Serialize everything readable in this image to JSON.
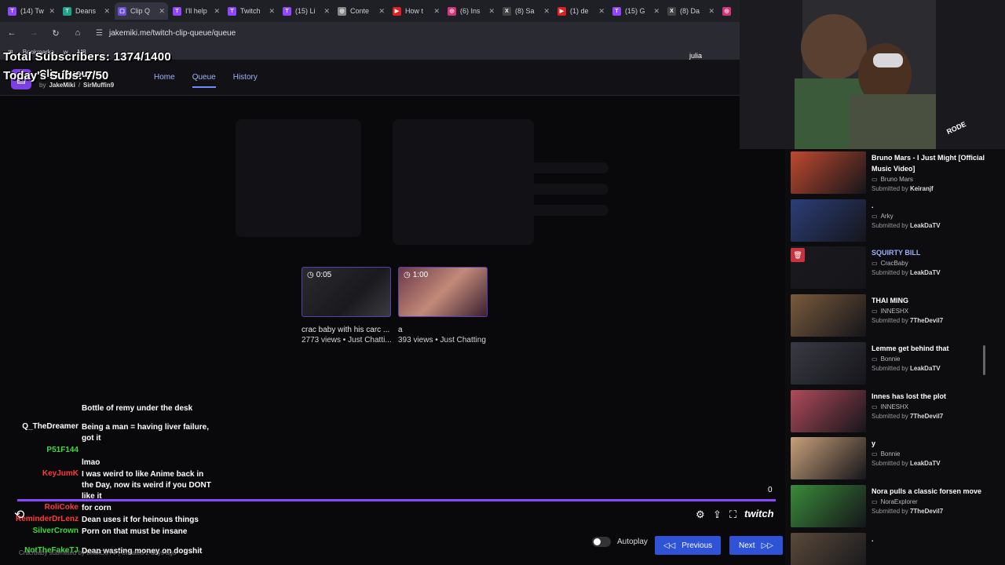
{
  "browser": {
    "tabs": [
      {
        "label": "(14) Tw",
        "color": "#9146ff",
        "glyph": "T"
      },
      {
        "label": "Deans",
        "color": "#1fa58c",
        "glyph": "T"
      },
      {
        "label": "Clip Q",
        "color": "#6f4ce0",
        "glyph": "▢",
        "active": true
      },
      {
        "label": "I'll help",
        "color": "#9146ff",
        "glyph": "T"
      },
      {
        "label": "Twitch",
        "color": "#9146ff",
        "glyph": "T"
      },
      {
        "label": "(15) Li",
        "color": "#9146ff",
        "glyph": "T"
      },
      {
        "label": "Conte",
        "color": "#888888",
        "glyph": "◎"
      },
      {
        "label": "How t",
        "color": "#e02020",
        "glyph": "▶"
      },
      {
        "label": "(6) Ins",
        "color": "#d6337a",
        "glyph": "◎"
      },
      {
        "label": "(8) Sa",
        "color": "#444444",
        "glyph": "X"
      },
      {
        "label": "(1) de",
        "color": "#e02020",
        "glyph": "▶"
      },
      {
        "label": "(15) G",
        "color": "#9146ff",
        "glyph": "T"
      },
      {
        "label": "(8) Da",
        "color": "#444444",
        "glyph": "X"
      },
      {
        "label": "",
        "color": "#d6337a",
        "glyph": "◎"
      }
    ],
    "tab_close": "✕",
    "url": "jakemiki.me/twitch-clip-queue/queue",
    "bookmarks": [
      "Bookmarks",
      "w",
      "M8"
    ]
  },
  "overlay": {
    "total_subs": "Total Subscribers: 1374/1400",
    "today_subs": "Today's Subs: 7/50",
    "name_tag": "julia"
  },
  "site": {
    "brand": "Clip Queue",
    "by_label": "by",
    "author1": "JakeMiki",
    "author2": "SirMuffin9",
    "nav": [
      {
        "label": "Home"
      },
      {
        "label": "Queue",
        "active": true
      },
      {
        "label": "History"
      }
    ]
  },
  "clips": [
    {
      "duration": "0:05",
      "title": "crac baby with his carc ...",
      "meta": "2773 views • Just Chatti..."
    },
    {
      "duration": "1:00",
      "title": "a",
      "meta": "393 views • Just Chatting"
    }
  ],
  "chat": [
    {
      "user": "",
      "msg": "Bottle of remy under the desk",
      "color": "#8a63d2"
    },
    {
      "user": "Q_TheDreamer",
      "msg": "Being a man = having liver failure, got it",
      "color": "#ffffff"
    },
    {
      "user": "P51F144",
      "msg": "",
      "color": "#3bdc3b"
    },
    {
      "user": "",
      "msg": "lmao",
      "color": "#5a5aff"
    },
    {
      "user": "KeyJumK",
      "msg": "I was weird to like Anime back in the Day, now its weird if you DONT like it",
      "color": "#ff3b3b"
    },
    {
      "user": "RoliCoke",
      "msg": "for corn",
      "color": "#ff3b3b"
    },
    {
      "user": "ReminderDrLenz",
      "msg": "Dean uses it for heinous things",
      "color": "#ff3b3b"
    },
    {
      "user": "SilverCrown",
      "msg": "Porn on that must be insane",
      "color": "#3bdc3b"
    },
    {
      "user": "NotTheFakeTJ",
      "msg": "Dean wasting money on dogshit",
      "color": "#3bdc3b"
    }
  ],
  "player": {
    "progress_value": "0",
    "progress_fraction": 1.0,
    "twitch_label": "twitch",
    "autoplay_label": "Autoplay",
    "autoplay_on": false,
    "prev_label": "Previous",
    "next_label": "Next"
  },
  "queue": [
    {
      "title": "Bruno Mars - I Just Might [Official Music Video]",
      "channel": "Bruno Mars",
      "submitted_label": "Submitted by",
      "submitter": "Keiranjf",
      "highlight": false,
      "thumb": "#c0492f"
    },
    {
      "title": ".",
      "channel": "Arky",
      "submitted_label": "Submitted by",
      "submitter": "LeakDaTV",
      "highlight": false,
      "thumb": "#2b3e78"
    },
    {
      "title": "SQUIRTY BILL",
      "channel": "CracBaby",
      "submitted_label": "Submitted by",
      "submitter": "LeakDaTV",
      "highlight": true,
      "thumb": "#1a1a1e"
    },
    {
      "title": "THAI MING",
      "channel": "INNESHX",
      "submitted_label": "Submitted by",
      "submitter": "7TheDevil7",
      "highlight": false,
      "thumb": "#7a5a3c"
    },
    {
      "title": "Lemme get behind that",
      "channel": "Bonnie",
      "submitted_label": "Submitted by",
      "submitter": "LeakDaTV",
      "highlight": false,
      "thumb": "#3a3a44"
    },
    {
      "title": "Innes has lost the plot",
      "channel": "INNESHX",
      "submitted_label": "Submitted by",
      "submitter": "7TheDevil7",
      "highlight": false,
      "thumb": "#b04a5a"
    },
    {
      "title": "y",
      "channel": "Bonnie",
      "submitted_label": "Submitted by",
      "submitter": "LeakDaTV",
      "highlight": false,
      "thumb": "#c8a07a"
    },
    {
      "title": "Nora pulls a classic forsen move",
      "channel": "NoraExplorer",
      "submitted_label": "Submitted by",
      "submitter": "7TheDevil7",
      "highlight": false,
      "thumb": "#3a8a3a"
    },
    {
      "title": ".",
      "channel": "",
      "submitted_label": "",
      "submitter": "",
      "highlight": false,
      "thumb": "#5a4a3a"
    }
  ],
  "webcam": {
    "mic_label": "RODE"
  },
  "footnote": "Crac/baby submitted by LeakDaTV | Created 2 days ago"
}
